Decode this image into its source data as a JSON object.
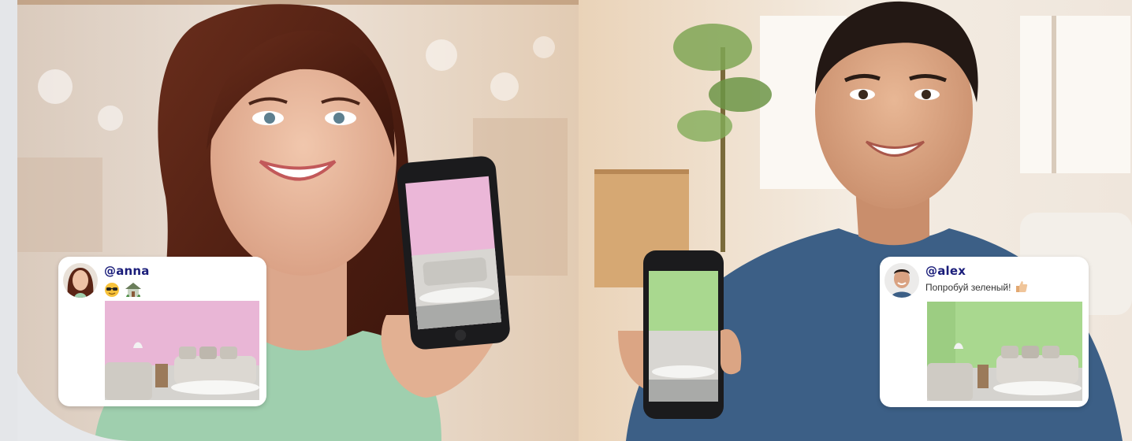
{
  "ad": {
    "colors": {
      "handle": "#1a1d7a",
      "pink_wall": "#e9b6d6",
      "green_wall": "#a9d88f",
      "card": "#ffffff",
      "sweater_mint": "#9fcfae",
      "shirt_blue": "#3c5f86"
    }
  },
  "posts": {
    "anna": {
      "handle": "@anna",
      "emoji": [
        "sunglasses-emoji",
        "house-emoji"
      ],
      "wall_color_name": "pink"
    },
    "alex": {
      "handle": "@alex",
      "message": "Попробуй зеленый!",
      "emoji": [
        "thumbs-up-emoji"
      ],
      "wall_color_name": "green"
    }
  }
}
